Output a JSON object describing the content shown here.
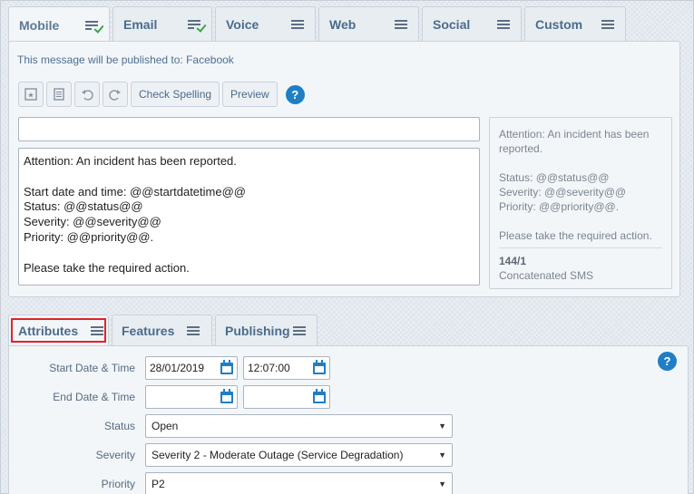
{
  "message_tabs": [
    {
      "label": "Mobile",
      "icon": "menu-check-icon"
    },
    {
      "label": "Email",
      "icon": "menu-check-icon"
    },
    {
      "label": "Voice",
      "icon": "menu-icon"
    },
    {
      "label": "Web",
      "icon": "menu-icon"
    },
    {
      "label": "Social",
      "icon": "menu-icon"
    },
    {
      "label": "Custom",
      "icon": "menu-icon"
    }
  ],
  "active_message_tab": "Mobile",
  "publish_note": "This message will be published to: Facebook",
  "toolbar": {
    "check_spelling": "Check Spelling",
    "preview": "Preview",
    "help": "?"
  },
  "subject_value": "",
  "message_body": [
    "Attention: An incident has been reported.",
    "",
    "Start date and time: @@startdatetime@@",
    "Status: @@status@@",
    "Severity: @@severity@@",
    "Priority: @@priority@@.",
    "",
    "Please take the required action."
  ],
  "preview": {
    "lines": [
      "Attention: An incident has been",
      "reported.",
      "",
      "Status: @@status@@",
      "Severity: @@severity@@",
      "Priority: @@priority@@.",
      "",
      "Please take the required action."
    ],
    "count": "144/1",
    "type": "Concatenated SMS"
  },
  "bottom_tabs": [
    {
      "label": "Attributes"
    },
    {
      "label": "Features"
    },
    {
      "label": "Publishing"
    }
  ],
  "active_bottom_tab": "Attributes",
  "attributes": {
    "help": "?",
    "start_label": "Start Date & Time",
    "start_date": "28/01/2019",
    "start_time": "12:07:00",
    "end_label": "End Date & Time",
    "end_date": "",
    "end_time": "",
    "status_label": "Status",
    "status_value": "Open",
    "severity_label": "Severity",
    "severity_value": "Severity 2 - Moderate Outage (Service Degradation)",
    "priority_label": "Priority",
    "priority_value": "P2"
  },
  "colors": {
    "accent": "#1f7ec6",
    "tab_text": "#4a6c8c",
    "highlight": "#e1232a",
    "check": "#3aa449"
  }
}
